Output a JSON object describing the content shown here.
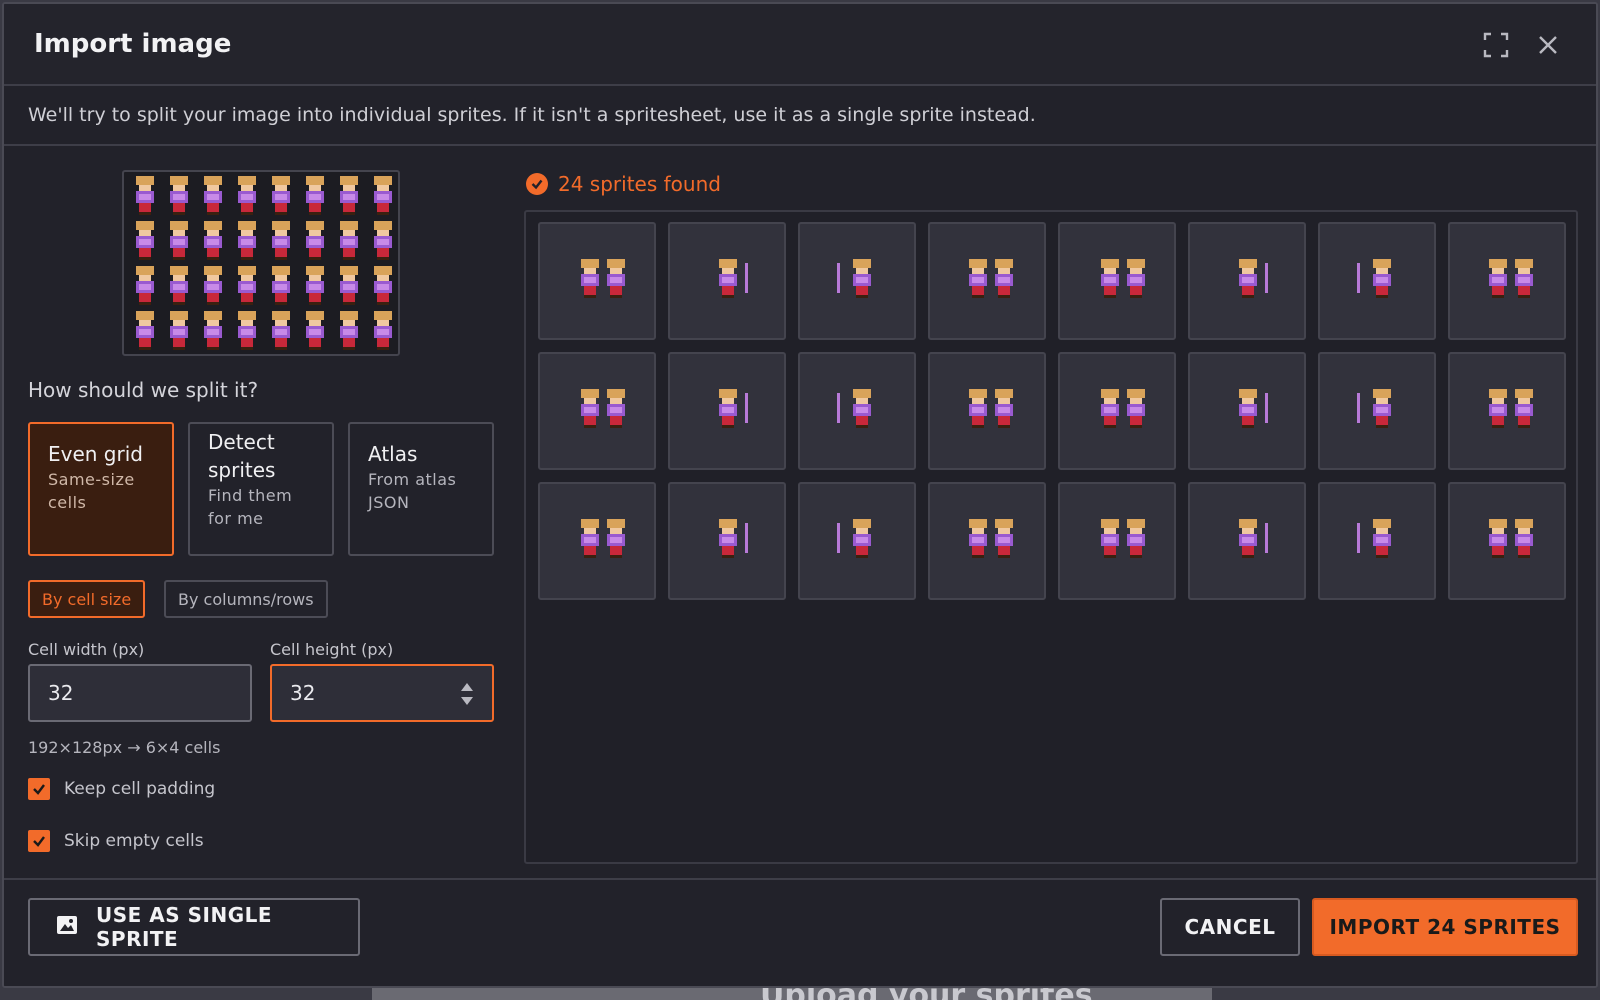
{
  "dialog": {
    "title": "Import image",
    "subtitle": "We'll try to split your image into individual sprites. If it isn't a spritesheet, use it as a single sprite instead.",
    "icons": {
      "fullscreen": "fullscreen-icon",
      "close": "close-icon"
    }
  },
  "split": {
    "label": "How should we split it?",
    "modes": [
      {
        "title": "Even grid",
        "desc": "Same-size cells",
        "active": true
      },
      {
        "title": "Detect sprites",
        "desc": "Find them for me",
        "active": false
      },
      {
        "title": "Atlas",
        "desc": "From atlas JSON",
        "active": false
      }
    ],
    "by": [
      {
        "label": "By cell size",
        "active": true
      },
      {
        "label": "By columns/rows",
        "active": false
      }
    ]
  },
  "cell": {
    "width_label": "Cell width (px)",
    "width_value": "32",
    "height_label": "Cell height (px)",
    "height_value": "32",
    "info": "192×128px → 6×4 cells"
  },
  "options": {
    "keep_padding": {
      "label": "Keep cell padding",
      "checked": true
    },
    "skip_empty": {
      "label": "Skip empty cells",
      "checked": true
    }
  },
  "result": {
    "found": "24 sprites found",
    "sprite_count": 24
  },
  "footer": {
    "single_label": "USE AS SINGLE SPRITE",
    "cancel_label": "CANCEL",
    "import_label": "IMPORT 24 SPRITES"
  },
  "backdrop": {
    "text": "Upload your sprites"
  },
  "colors": {
    "accent": "#f26b2a",
    "bg": "#22222a",
    "cell_bg": "#32323c"
  }
}
